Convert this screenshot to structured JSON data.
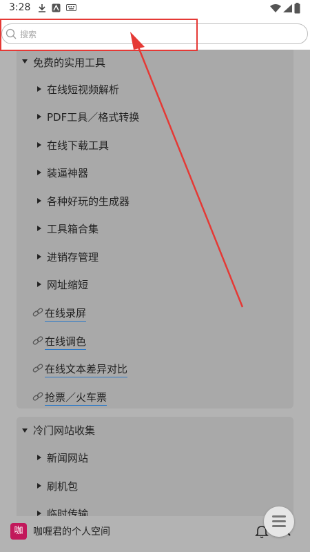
{
  "status_bar": {
    "time": "3:28"
  },
  "search": {
    "placeholder": "搜索"
  },
  "panel1": {
    "title": "免费的实用工具",
    "subitems": [
      "在线短视频解析",
      "PDF工具／格式转换",
      "在线下载工具",
      "装逼神器",
      "各种好玩的生成器",
      "工具箱合集",
      "进销存管理",
      "网址缩短"
    ],
    "links": [
      "在线录屏",
      "在线调色",
      "在线文本差异对比",
      "抢票／火车票"
    ]
  },
  "panel2": {
    "title": "冷门网站收集",
    "subitems": [
      "新闻网站",
      "刷机包",
      "临时传输"
    ]
  },
  "bottom_bar": {
    "avatar_text": "咖",
    "site_title": "咖喱君的个人空间"
  },
  "colors": {
    "highlight_red": "#e53935",
    "link_underline": "#2a78c8",
    "avatar_bg": "#c2185b"
  }
}
